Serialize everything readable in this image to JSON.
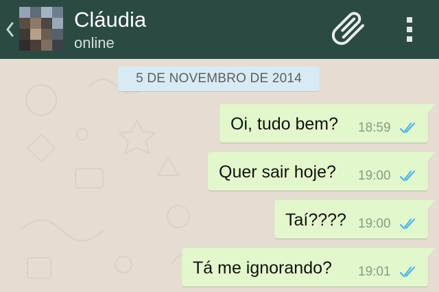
{
  "header": {
    "contact_name": "Cláudia",
    "status": "online",
    "icons": {
      "back": "chevron-left-icon",
      "attach": "paperclip-icon",
      "menu": "overflow-menu-icon"
    },
    "colors": {
      "bar": "#2b4a44",
      "text": "#ffffff"
    }
  },
  "chat": {
    "date_label": "5 DE NOVEMBRO DE 2014",
    "messages": [
      {
        "text": "Oi, tudo bem?",
        "time": "18:59",
        "status": "read"
      },
      {
        "text": "Quer sair hoje?",
        "time": "19:00",
        "status": "read"
      },
      {
        "text": "Taí????",
        "time": "19:00",
        "status": "read"
      },
      {
        "text": "Tá me ignorando?",
        "time": "19:01",
        "status": "read"
      }
    ],
    "colors": {
      "background": "#e6ddd2",
      "outgoing_bubble": "#e2f7cb",
      "date_badge": "#d8ebf4",
      "read_ticks": "#4fb3e5"
    }
  }
}
